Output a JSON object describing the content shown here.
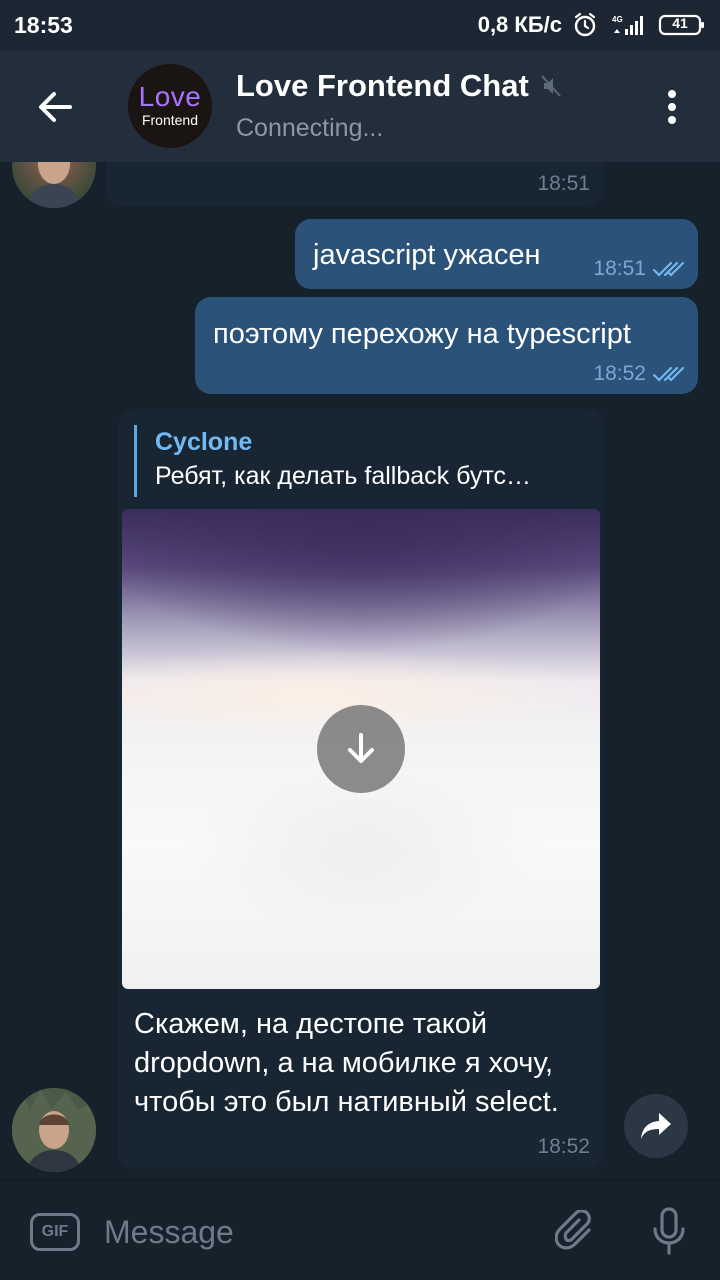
{
  "status_bar": {
    "time": "18:53",
    "speed": "0,8 КБ/с",
    "network": "4G",
    "battery": "41"
  },
  "header": {
    "title": "Love Frontend Chat",
    "subtitle": "Connecting...",
    "avatar_line1": "Love",
    "avatar_line2": "Frontend",
    "icons": {
      "back": "arrow-left-icon",
      "muted": "muted-icon",
      "menu": "more-vertical-icon"
    }
  },
  "messages": [
    {
      "id": "m1",
      "direction": "in",
      "text": "",
      "time": "18:51"
    },
    {
      "id": "m2",
      "direction": "out",
      "text": "javascript ужасен",
      "time": "18:51",
      "read": true
    },
    {
      "id": "m3",
      "direction": "out",
      "text": "поэтому перехожу на typescript",
      "time": "18:52",
      "read": true
    },
    {
      "id": "m4",
      "direction": "in",
      "reply": {
        "author": "Cyclone",
        "text": "Ребят, как делать fallback бутс…"
      },
      "media": {
        "type": "image",
        "state": "not-downloaded"
      },
      "text": "Скажем, на дестопе такой dropdown, а на мобилке я хочу, чтобы это был нативный select.",
      "time": "18:52"
    }
  ],
  "composer": {
    "gif_label": "GIF",
    "placeholder": "Message",
    "value": ""
  },
  "colors": {
    "background": "#17212b",
    "header": "#232e3c",
    "bubble_in": "#182533",
    "bubble_out": "#2b5278",
    "accent": "#71baf3",
    "muted_text": "#6d7f8f"
  }
}
